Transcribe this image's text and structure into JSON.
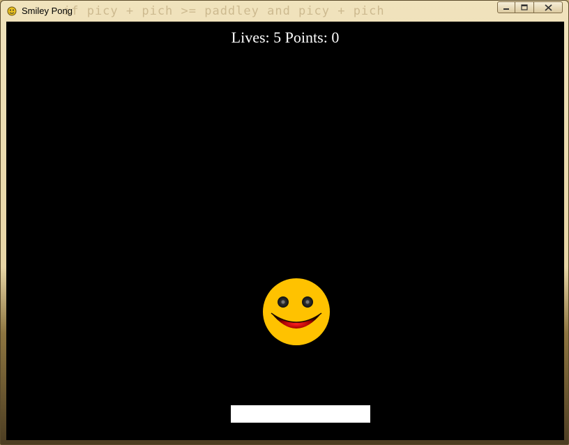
{
  "window": {
    "title": "Smiley Pong",
    "background_code": "if picy + pich >= paddley and picy + pich",
    "controls": {
      "minimize_icon": "minimize-icon",
      "maximize_icon": "maximize-icon",
      "close_icon": "close-icon"
    }
  },
  "hud": {
    "lives_label": "Lives:",
    "lives": "5",
    "points_label": "Points:",
    "points": "0"
  },
  "colors": {
    "game_bg": "#000000",
    "paddle": "#ffffff",
    "smiley_face": "#ffc200",
    "text": "#ffffff"
  },
  "sprites": {
    "ball_icon": "smiley-face-icon"
  }
}
